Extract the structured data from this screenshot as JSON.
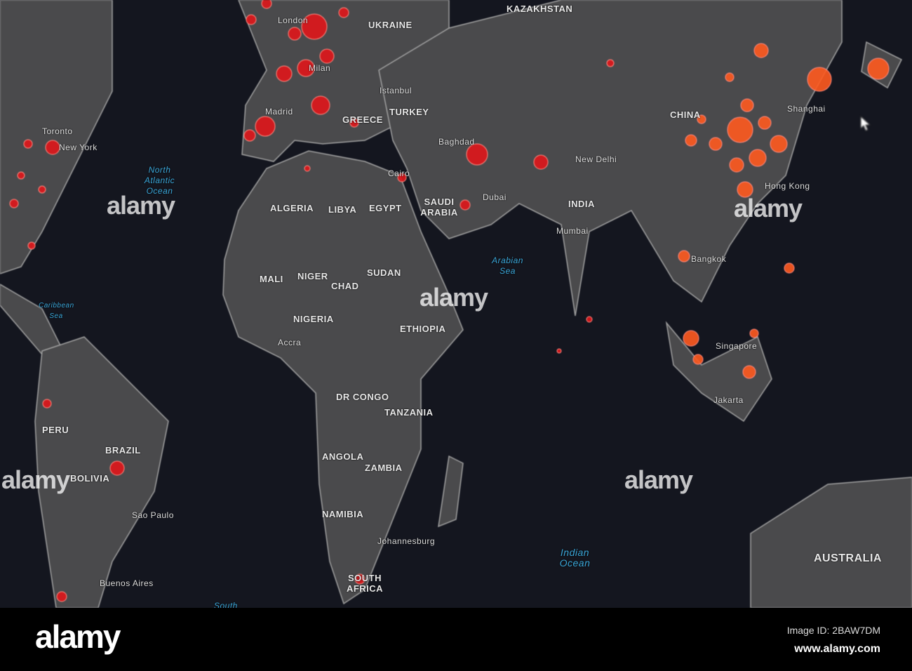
{
  "map": {
    "countries": [
      "KAZAKHSTAN",
      "UKRAINE",
      "TURKEY",
      "GREECE",
      "ALGERIA",
      "LIBYA",
      "EGYPT",
      "SAUDI ARABIA",
      "MALI",
      "NIGER",
      "CHAD",
      "SUDAN",
      "NIGERIA",
      "ETHIOPIA",
      "DR CONGO",
      "TANZANIA",
      "ANGOLA",
      "ZAMBIA",
      "NAMIBIA",
      "SOUTH AFRICA",
      "INDIA",
      "CHINA",
      "BRAZIL",
      "PERU",
      "BOLIVIA",
      "AUSTRALIA"
    ],
    "cities": [
      "London",
      "Madrid",
      "Milan",
      "Istanbul",
      "Baghdad",
      "Cairo",
      "Dubai",
      "New Delhi",
      "Mumbai",
      "Shanghai",
      "Hong Kong",
      "Bangkok",
      "Singapore",
      "Jakarta",
      "Accra",
      "Johannesburg",
      "New York",
      "Sao Paulo",
      "Buenos Aires",
      "Toronto"
    ],
    "oceans": [
      "North Atlantic Ocean",
      "Arabian Sea",
      "Indian Ocean",
      "Caribbean Sea",
      "South"
    ]
  },
  "watermark": {
    "brand": "alamy",
    "image_id": "Image ID: 2BAW7DM",
    "url": "www.alamy.com"
  },
  "colors": {
    "background": "#14161f",
    "land": "#4a4a4c",
    "border": "#9a9a9a",
    "case_dot": "#e0161b",
    "hotspot_dot": "#ff5a1f"
  }
}
